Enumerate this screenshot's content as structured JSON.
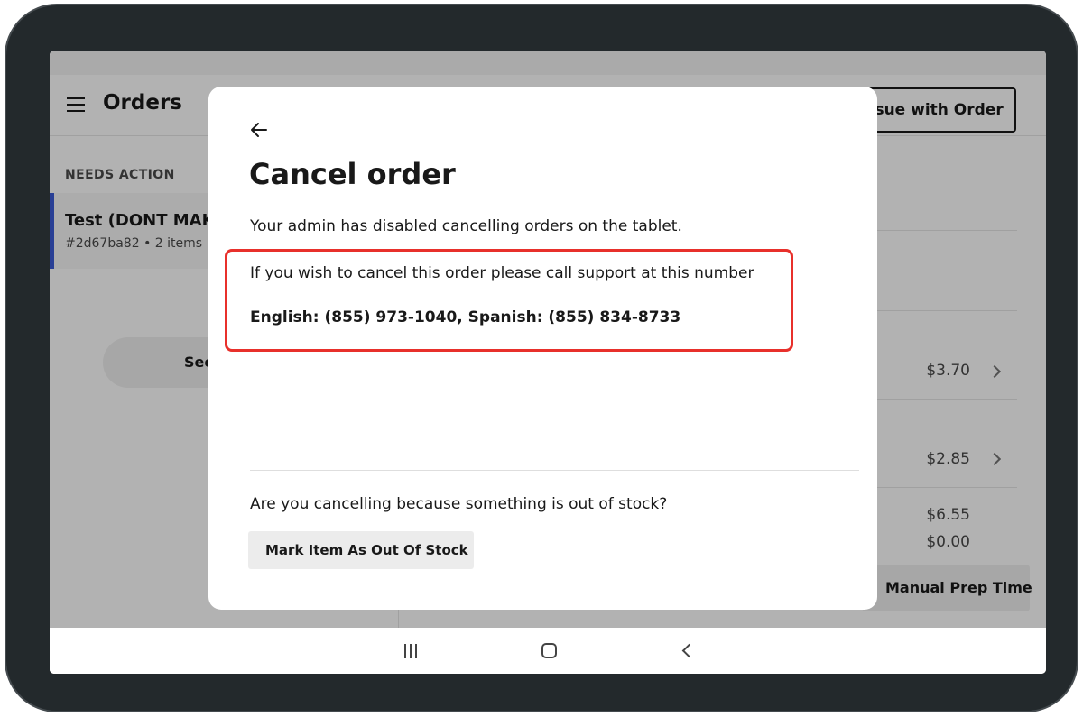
{
  "app": {
    "title": "Orders",
    "issue_button_label": "Issue with Order",
    "sidebar": {
      "section_header": "NEEDS ACTION",
      "order": {
        "title": "Test (DONT MAKE",
        "meta": "#2d67ba82 • 2 items"
      },
      "see_button_label": "See"
    },
    "main": {
      "item_prices": [
        "$3.70",
        "$2.85"
      ],
      "subtotal": "$6.55",
      "tax": "$0.00",
      "prep_button_label": "Manual Prep Time"
    }
  },
  "modal": {
    "title": "Cancel order",
    "disabled_message": "Your admin has disabled cancelling orders on the tablet.",
    "support_message": "If you wish to cancel this order please call support at this number",
    "phone_numbers": "English: (855) 973-1040, Spanish: (855) 834-8733",
    "out_of_stock_question": "Are you cancelling because something is out of stock?",
    "out_of_stock_button_label": "Mark Item As Out Of Stock"
  },
  "colors": {
    "highlight_border": "#e8302b",
    "selected_order_accent": "#3b5bd6",
    "device_frame": "#23292c"
  },
  "icons": {
    "menu": "hamburger-icon",
    "back": "arrow-left-icon",
    "chevron": "chevron-right-icon",
    "nav_recents": "recents-icon",
    "nav_home": "home-icon",
    "nav_back": "nav-back-icon"
  }
}
